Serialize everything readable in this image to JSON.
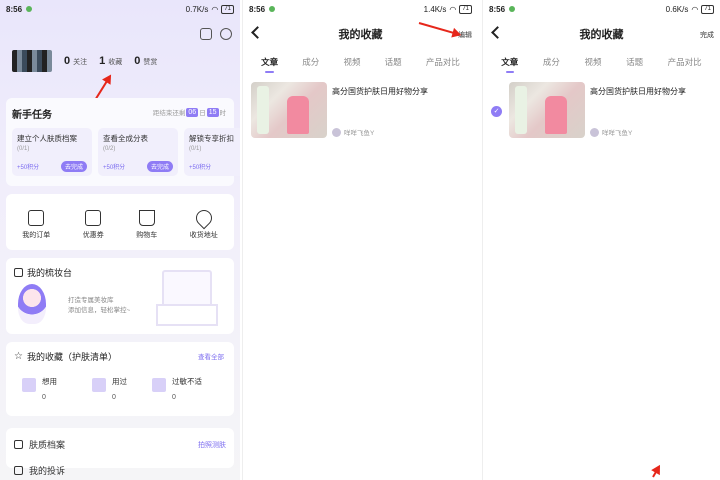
{
  "status_bars": [
    {
      "time": "8:56",
      "speed": "0.7K/s",
      "battery": "71"
    },
    {
      "time": "8:56",
      "speed": "1.4K/s",
      "battery": "71"
    },
    {
      "time": "8:56",
      "speed": "0.6K/s",
      "battery": "71"
    }
  ],
  "profile": {
    "following_count": "0",
    "following_label": "关注",
    "collect_count": "1",
    "collect_label": "收藏",
    "likes_count": "0",
    "likes_label": "赞赏"
  },
  "tasks": {
    "title": "新手任务",
    "countdown_prefix": "距结束还剩",
    "countdown": [
      "06",
      "日",
      "15",
      "时"
    ],
    "items": [
      {
        "title": "建立个人肤质档案",
        "progress": "(0/1)",
        "points": "+50积分",
        "action": "去完成"
      },
      {
        "title": "查看全成分表",
        "progress": "(0/2)",
        "points": "+50积分",
        "action": "去完成"
      },
      {
        "title": "解锁专享折扣",
        "progress": "(0/1)",
        "points": "+50积分",
        "action": ""
      }
    ]
  },
  "orders": [
    {
      "label": "我的订单",
      "icon": "clipboard-icon"
    },
    {
      "label": "优惠券",
      "icon": "coupon-icon"
    },
    {
      "label": "购物车",
      "icon": "cart-icon"
    },
    {
      "label": "收货地址",
      "icon": "location-icon"
    }
  ],
  "vanity": {
    "title": "我的梳妆台",
    "desc_line1": "打造专属美妆库",
    "desc_line2": "添加信息，轻松掌控~"
  },
  "favorites": {
    "title": "我的收藏（护肤清单）",
    "view_all": "查看全部",
    "items": [
      {
        "label": "想用",
        "count": "0"
      },
      {
        "label": "用过",
        "count": "0"
      },
      {
        "label": "过敏不适",
        "count": "0"
      }
    ]
  },
  "skin_file": {
    "label": "肤质档案",
    "action": "拍照测肤"
  },
  "next_row": {
    "label": "我的投诉"
  },
  "collection_page": {
    "title": "我的收藏",
    "edit_label": "编辑",
    "done_label": "完成",
    "tabs": [
      "文章",
      "成分",
      "视频",
      "话题",
      "产品对比"
    ],
    "article": {
      "title": "高分国货护肤日用好物分享",
      "author": "咩咩飞鱼Y"
    }
  },
  "colors": {
    "accent": "#8f7cf5",
    "annotation_arrow": "#e6271b"
  }
}
